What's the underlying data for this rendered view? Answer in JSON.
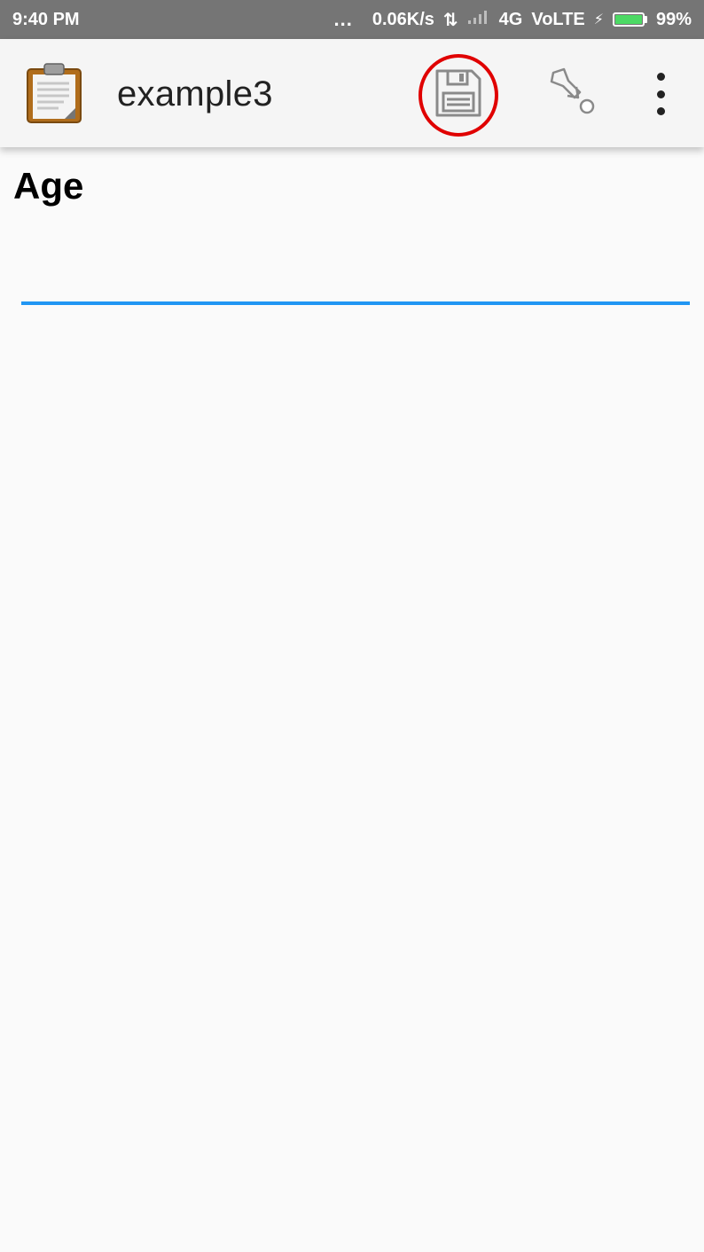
{
  "status_bar": {
    "time": "9:40 PM",
    "dots": "...",
    "speed": "0.06K/s",
    "data_arrows": "⇅",
    "network": "4G",
    "volte": "VoLTE",
    "charging": "⚡",
    "battery_percent": "99%",
    "battery_level": 0.99,
    "battery_color": "#4cd964"
  },
  "app_bar": {
    "app_icon": "clipboard-icon",
    "title": "example3",
    "save_icon": "floppy-disk-icon",
    "goto_icon": "go-to-question-icon",
    "menu_icon": "more-vert-icon"
  },
  "form": {
    "question_label": "Age",
    "answer_value": "",
    "accent_color": "#2196f3"
  }
}
